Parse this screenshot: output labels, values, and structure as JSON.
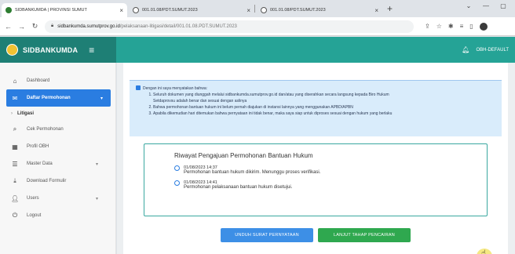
{
  "browser": {
    "tabs": [
      {
        "title": "SIDBANKUMDA | PROVINSI SUMUT",
        "active": true,
        "favicon_color": "#2e7d32"
      },
      {
        "title": "001.01.08/PDT.SUMUT.2023",
        "active": false,
        "favicon_color": "#555555"
      },
      {
        "title": "001.01.08/PDT.SUMUT.2023",
        "active": false,
        "favicon_color": "#555555"
      }
    ],
    "new_tab": "+",
    "url_host": "sidbankumda.sumutprov.go.id",
    "url_path": "/pelaksanaan-litigasi/detail/001.01.08.PDT.SUMUT.2023"
  },
  "header": {
    "brand": "SIDBANKUMDA",
    "user": "OBH-DEFAULT",
    "brand_color": "#1e7f75",
    "bar_color": "#25a396"
  },
  "sidebar": {
    "items": [
      {
        "label": "Dashboard",
        "icon": "home-icon"
      },
      {
        "label": "Daftar Permohonan",
        "icon": "envelope-icon",
        "active": true
      },
      {
        "label": "Cek Permohonan",
        "icon": "search-icon"
      },
      {
        "label": "Profil OBH",
        "icon": "grid-icon"
      },
      {
        "label": "Master Data",
        "icon": "list-icon"
      },
      {
        "label": "Download Formulir",
        "icon": "download-icon"
      },
      {
        "label": "Users",
        "icon": "user-icon"
      },
      {
        "label": "Logout",
        "icon": "power-icon"
      }
    ],
    "sub_item": "Litigasi",
    "active_color": "#2a7de1"
  },
  "notice": {
    "intro": "Dengan ini saya menyatakan bahwa:",
    "points": [
      "Seluruh dokumen yang diunggah melalui sidbankumda.sumutprov.go.id dan/atau yang diserahkan secara langsung kepada Biro Hukum",
      "Bahwa permohonan bantuan hukum ini belum pernah diajukan di instansi lainnya yang menggunakan APBD/APBN",
      "Apabila dikemudian hari ditemukan bahwa pernyataan ini tidak benar, maka saya siap untuk diproses sesuai dengan hukum yang berlaku"
    ],
    "point1_cont": "Setdaprovsu adalah benar dan sesuai dengan aslinya"
  },
  "timeline": {
    "title": "Riwayat Pengajuan Permohonan Bantuan Hukum",
    "entries": [
      {
        "date": "01/08/2023 14:37",
        "text": "Permohonan bantuan hukum dikirim. Menunggu proses verifikasi."
      },
      {
        "date": "01/08/2023 14:41",
        "text": "Permohonan pelaksanaan bantuan hukum disetujui."
      }
    ]
  },
  "actions": {
    "unduh_label": "UNDUH SURAT PERNYATAAN",
    "lanjut_label": "LANJUT TAHAP PENCAIRAN"
  }
}
